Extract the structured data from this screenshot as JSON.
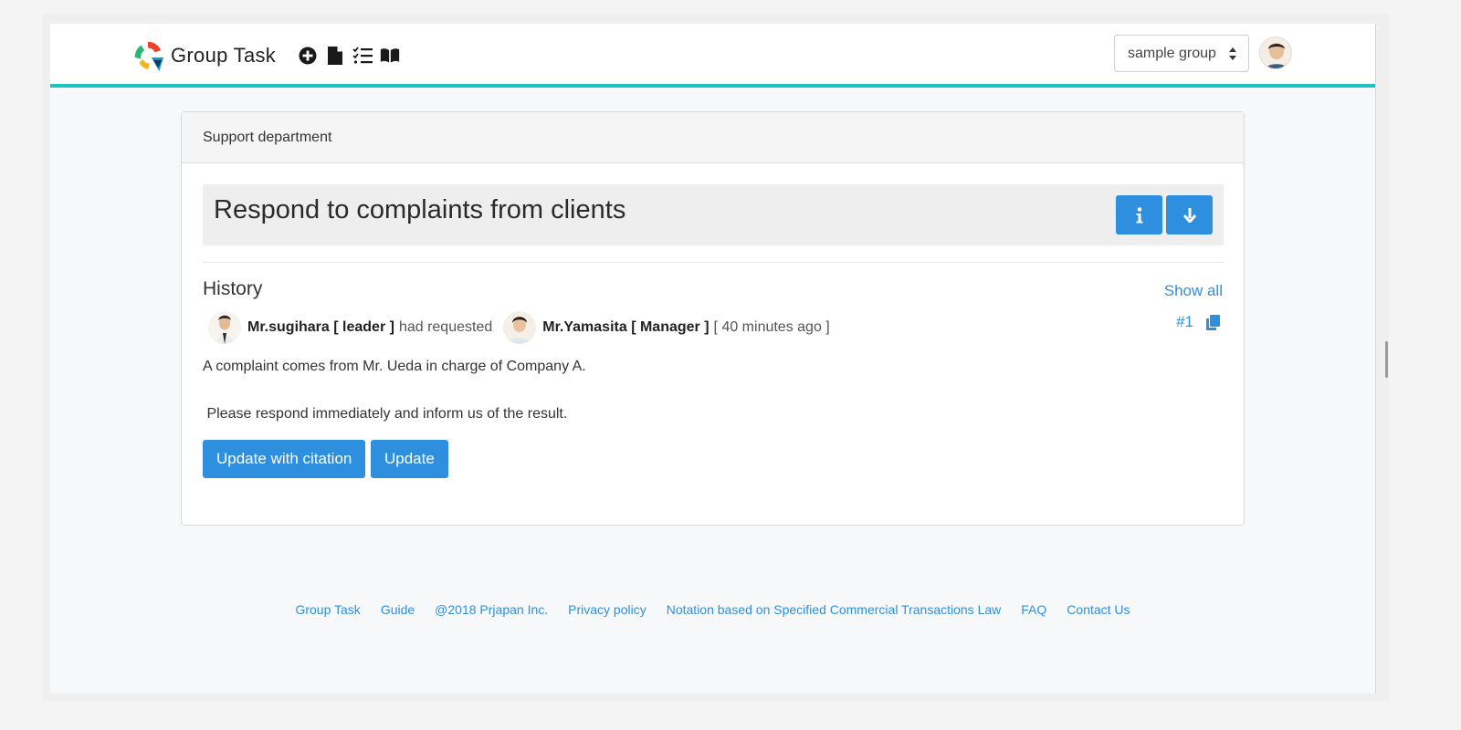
{
  "header": {
    "brand_title": "Group Task",
    "group_select_value": "sample group",
    "icons": [
      "plus-circle-icon",
      "document-icon",
      "checklist-icon",
      "book-icon"
    ]
  },
  "card": {
    "department": "Support department",
    "task_title": "Respond to complaints from clients",
    "history_label": "History",
    "show_all": "Show all",
    "entry": {
      "requester": "Mr.sugihara [ leader ]",
      "action": "had requested",
      "assignee": "Mr.Yamasita [ Manager ]",
      "time": "[ 40 minutes ago ]",
      "number": "#1",
      "line1": "A complaint comes from Mr. Ueda in charge of Company A.",
      "line2": " Please respond immediately and inform us of the result."
    },
    "buttons": {
      "update_with_citation": "Update with citation",
      "update": "Update"
    }
  },
  "footer": {
    "links": [
      "Group Task",
      "Guide",
      "@2018 Prjapan Inc.",
      "Privacy policy",
      "Notation based on Specified Commercial Transactions Law",
      "FAQ",
      "Contact Us"
    ]
  },
  "colors": {
    "accent": "#2f8fdf",
    "header_border": "#1fc2c2"
  }
}
